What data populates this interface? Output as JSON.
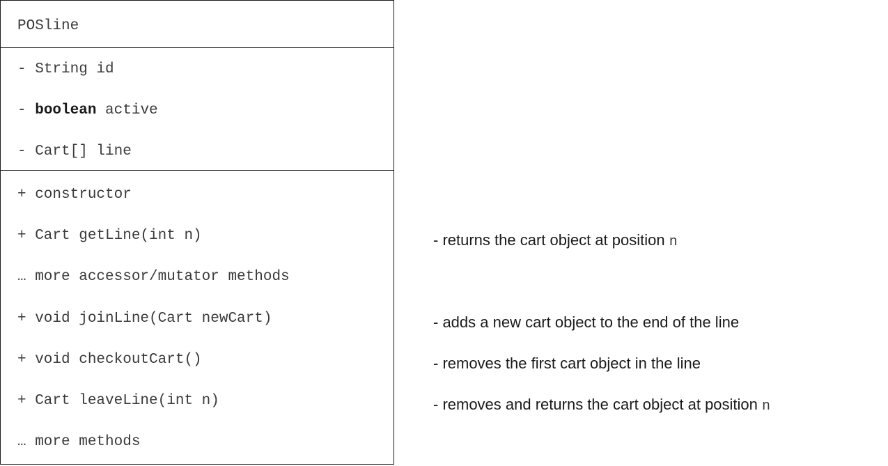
{
  "class_box": {
    "name": "POSline",
    "attributes": [
      {
        "prefix": "- ",
        "keyword": "",
        "text": "String id"
      },
      {
        "prefix": "- ",
        "keyword": "boolean",
        "text": " active"
      },
      {
        "prefix": "- ",
        "keyword": "",
        "text": "Cart[] line"
      }
    ],
    "methods": [
      "+ constructor",
      "+ Cart getLine(int n)",
      "… more accessor/mutator methods",
      "+ void joinLine(Cart newCart)",
      "+ void checkoutCart()",
      "+ Cart leaveLine(int n)",
      "… more methods"
    ]
  },
  "notes": [
    {
      "text": "- returns the cart object at position ",
      "code": "n"
    },
    {
      "text": "- adds a new cart object to the end of the line",
      "code": ""
    },
    {
      "text": "- removes the first cart object in the line",
      "code": ""
    },
    {
      "text": "- removes and returns the cart object at position ",
      "code": "n"
    }
  ]
}
